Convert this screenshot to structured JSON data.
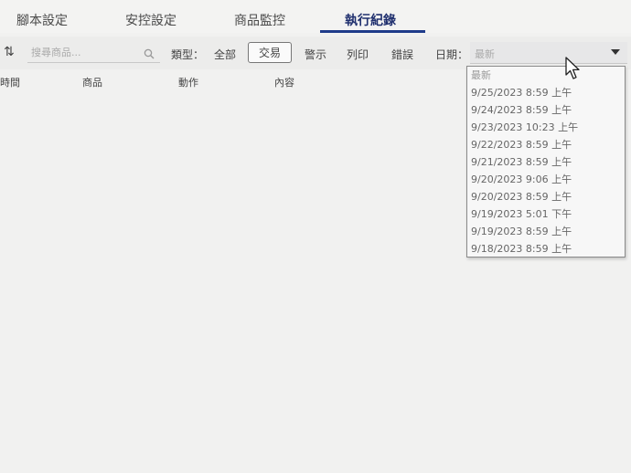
{
  "tabs": [
    {
      "label": "腳本設定",
      "active": false
    },
    {
      "label": "安控設定",
      "active": false
    },
    {
      "label": "商品監控",
      "active": false
    },
    {
      "label": "執行紀錄",
      "active": true
    }
  ],
  "toolbar": {
    "sort_icon": "sort-arrows-icon",
    "search_placeholder": "搜尋商品...",
    "search_icon": "search-icon",
    "type_label": "類型：",
    "filters": [
      {
        "label": "全部",
        "selected": false
      },
      {
        "label": "交易",
        "selected": true
      },
      {
        "label": "警示",
        "selected": false
      },
      {
        "label": "列印",
        "selected": false
      },
      {
        "label": "錯誤",
        "selected": false
      }
    ],
    "date_label": "日期：",
    "date_value": "最新"
  },
  "columns": [
    "時間",
    "商品",
    "動作",
    "內容"
  ],
  "date_options": [
    "最新",
    "9/25/2023 8:59 上午",
    "9/24/2023 8:59 上午",
    "9/23/2023 10:23 上午",
    "9/22/2023 8:59 上午",
    "9/21/2023 8:59 上午",
    "9/20/2023 9:06 上午",
    "9/20/2023 8:59 上午",
    "9/19/2023 5:01 下午",
    "9/19/2023 8:59 上午",
    "9/18/2023 8:59 上午"
  ],
  "colors": {
    "active_tab": "#1f2f6e",
    "accent_underline": "#1f3b8a"
  }
}
